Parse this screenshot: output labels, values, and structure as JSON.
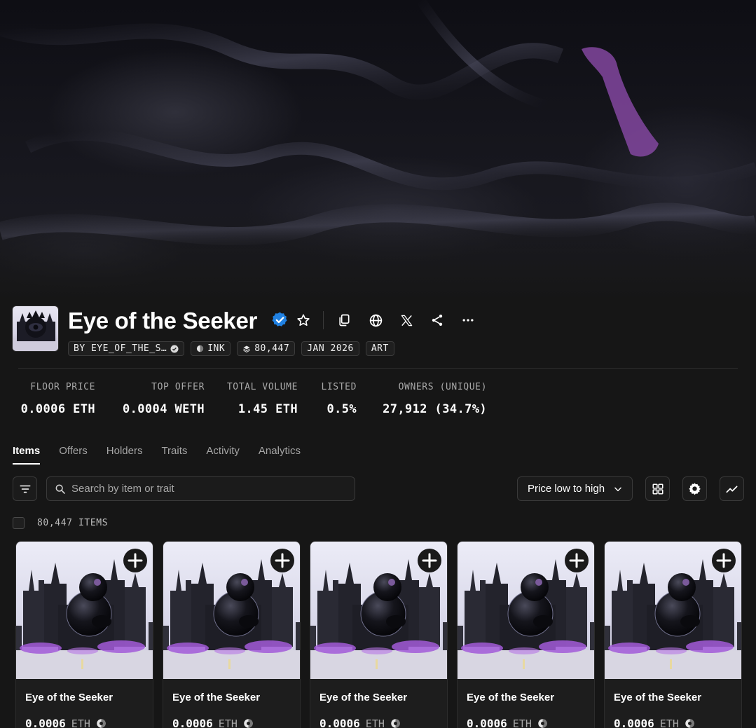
{
  "collection": {
    "title": "Eye of the Seeker",
    "chips": {
      "creator": "BY EYE_OF_THE_S…",
      "chain": "INK",
      "supply": "80,447",
      "date": "JAN 2026",
      "category": "ART"
    }
  },
  "stats": [
    {
      "label": "FLOOR PRICE",
      "value": "0.0006 ETH"
    },
    {
      "label": "TOP OFFER",
      "value": "0.0004 WETH"
    },
    {
      "label": "TOTAL VOLUME",
      "value": "1.45 ETH"
    },
    {
      "label": "LISTED",
      "value": "0.5%"
    },
    {
      "label": "OWNERS (UNIQUE)",
      "value": "27,912 (34.7%)"
    }
  ],
  "tabs": [
    "Items",
    "Offers",
    "Holders",
    "Traits",
    "Activity",
    "Analytics"
  ],
  "active_tab": "Items",
  "toolbar": {
    "search_placeholder": "Search by item or trait",
    "sort_label": "Price low to high"
  },
  "items_count": "80,447 ITEMS",
  "cards": [
    {
      "name": "Eye of the Seeker",
      "price": "0.0006",
      "unit": "ETH"
    },
    {
      "name": "Eye of the Seeker",
      "price": "0.0006",
      "unit": "ETH"
    },
    {
      "name": "Eye of the Seeker",
      "price": "0.0006",
      "unit": "ETH"
    },
    {
      "name": "Eye of the Seeker",
      "price": "0.0006",
      "unit": "ETH"
    },
    {
      "name": "Eye of the Seeker",
      "price": "0.0006",
      "unit": "ETH"
    }
  ],
  "icons": {
    "verified": "verified-badge-icon",
    "favorite": "star-icon",
    "copy": "copy-icon",
    "website": "globe-icon",
    "x": "x-logo-icon",
    "share": "share-icon",
    "more": "more-icon",
    "filter": "filter-icon",
    "search": "search-icon",
    "sort": "chevron-down-icon",
    "grid": "grid-view-icon",
    "settings": "gear-icon",
    "chart": "chart-icon",
    "add": "plus-circle-icon",
    "chain": "ink-chain-icon"
  },
  "colors": {
    "background": "#161616",
    "verified": "#2081e2",
    "accent_purple": "#a25bd8"
  }
}
